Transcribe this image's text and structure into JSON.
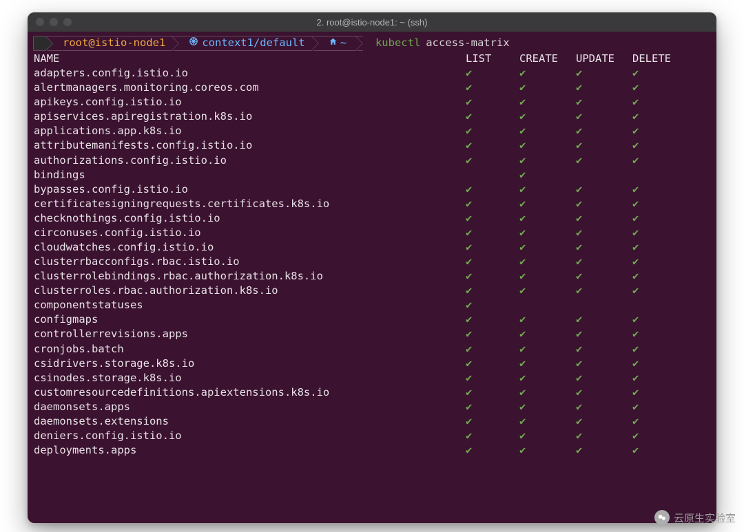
{
  "window": {
    "title": "2. root@istio-node1: ~ (ssh)"
  },
  "prompt": {
    "host": "root@istio-node1",
    "context": "context1/default",
    "path": "~",
    "command": "kubectl",
    "arg": "access-matrix"
  },
  "headers": {
    "name": "NAME",
    "list": "LIST",
    "create": "CREATE",
    "update": "UPDATE",
    "delete": "DELETE"
  },
  "check_glyph": "✔",
  "rows": [
    {
      "name": "adapters.config.istio.io",
      "list": true,
      "create": true,
      "update": true,
      "delete": true
    },
    {
      "name": "alertmanagers.monitoring.coreos.com",
      "list": true,
      "create": true,
      "update": true,
      "delete": true
    },
    {
      "name": "apikeys.config.istio.io",
      "list": true,
      "create": true,
      "update": true,
      "delete": true
    },
    {
      "name": "apiservices.apiregistration.k8s.io",
      "list": true,
      "create": true,
      "update": true,
      "delete": true
    },
    {
      "name": "applications.app.k8s.io",
      "list": true,
      "create": true,
      "update": true,
      "delete": true
    },
    {
      "name": "attributemanifests.config.istio.io",
      "list": true,
      "create": true,
      "update": true,
      "delete": true
    },
    {
      "name": "authorizations.config.istio.io",
      "list": true,
      "create": true,
      "update": true,
      "delete": true
    },
    {
      "name": "bindings",
      "list": false,
      "create": true,
      "update": false,
      "delete": false
    },
    {
      "name": "bypasses.config.istio.io",
      "list": true,
      "create": true,
      "update": true,
      "delete": true
    },
    {
      "name": "certificatesigningrequests.certificates.k8s.io",
      "list": true,
      "create": true,
      "update": true,
      "delete": true
    },
    {
      "name": "checknothings.config.istio.io",
      "list": true,
      "create": true,
      "update": true,
      "delete": true
    },
    {
      "name": "circonuses.config.istio.io",
      "list": true,
      "create": true,
      "update": true,
      "delete": true
    },
    {
      "name": "cloudwatches.config.istio.io",
      "list": true,
      "create": true,
      "update": true,
      "delete": true
    },
    {
      "name": "clusterrbacconfigs.rbac.istio.io",
      "list": true,
      "create": true,
      "update": true,
      "delete": true
    },
    {
      "name": "clusterrolebindings.rbac.authorization.k8s.io",
      "list": true,
      "create": true,
      "update": true,
      "delete": true
    },
    {
      "name": "clusterroles.rbac.authorization.k8s.io",
      "list": true,
      "create": true,
      "update": true,
      "delete": true
    },
    {
      "name": "componentstatuses",
      "list": true,
      "create": false,
      "update": false,
      "delete": false
    },
    {
      "name": "configmaps",
      "list": true,
      "create": true,
      "update": true,
      "delete": true
    },
    {
      "name": "controllerrevisions.apps",
      "list": true,
      "create": true,
      "update": true,
      "delete": true
    },
    {
      "name": "cronjobs.batch",
      "list": true,
      "create": true,
      "update": true,
      "delete": true
    },
    {
      "name": "csidrivers.storage.k8s.io",
      "list": true,
      "create": true,
      "update": true,
      "delete": true
    },
    {
      "name": "csinodes.storage.k8s.io",
      "list": true,
      "create": true,
      "update": true,
      "delete": true
    },
    {
      "name": "customresourcedefinitions.apiextensions.k8s.io",
      "list": true,
      "create": true,
      "update": true,
      "delete": true
    },
    {
      "name": "daemonsets.apps",
      "list": true,
      "create": true,
      "update": true,
      "delete": true
    },
    {
      "name": "daemonsets.extensions",
      "list": true,
      "create": true,
      "update": true,
      "delete": true
    },
    {
      "name": "deniers.config.istio.io",
      "list": true,
      "create": true,
      "update": true,
      "delete": true
    },
    {
      "name": "deployments.apps",
      "list": true,
      "create": true,
      "update": true,
      "delete": true
    }
  ],
  "watermark": {
    "text": "云原生实验室"
  }
}
